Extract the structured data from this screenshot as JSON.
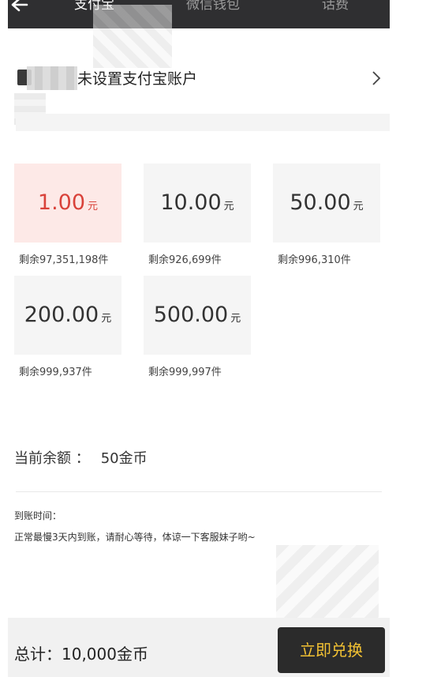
{
  "tabs": [
    {
      "label": "支付宝",
      "active": true
    },
    {
      "label": "微信钱包",
      "active": false
    },
    {
      "label": "话费",
      "active": false
    }
  ],
  "account": {
    "label": "未设置支付宝账户"
  },
  "amounts": [
    {
      "value": "1.00",
      "unit": "元",
      "remaining": "剩余97,351,198件",
      "selected": true
    },
    {
      "value": "10.00",
      "unit": "元",
      "remaining": "剩余926,699件",
      "selected": false
    },
    {
      "value": "50.00",
      "unit": "元",
      "remaining": "剩余996,310件",
      "selected": false
    },
    {
      "value": "200.00",
      "unit": "元",
      "remaining": "剩余999,937件",
      "selected": false
    },
    {
      "value": "500.00",
      "unit": "元",
      "remaining": "剩余999,997件",
      "selected": false
    }
  ],
  "balance": {
    "label": "当前余额 ：",
    "value": "50金币"
  },
  "arrival": {
    "title": "到账时间：",
    "text": "正常最慢3天内到账，请耐心等待，体谅一下客服妹子哟~"
  },
  "footer": {
    "total": "总计：10,000金币",
    "button": "立即兑换"
  },
  "colors": {
    "tabbar": "#2f2f31",
    "selected_bg": "#fde9e7",
    "selected_text": "#d9423a",
    "button_bg": "#2b2b2b",
    "button_text": "#f3c233"
  }
}
